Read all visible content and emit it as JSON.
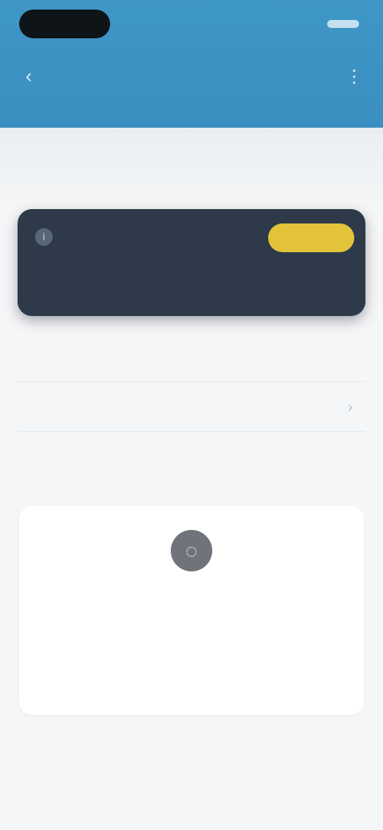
{
  "status_bar": {
    "time_pill": "",
    "right_text": ""
  },
  "nav": {
    "back_icon": "back-arrow-icon",
    "title": "",
    "action_icon": "more-icon"
  },
  "caption": "",
  "promo": {
    "icon": "info-icon",
    "title": "",
    "badge": "",
    "description": ""
  },
  "list": [
    {
      "label": "",
      "value": ""
    },
    {
      "label": "",
      "value": ""
    }
  ],
  "section_title": "",
  "empty_state": {
    "icon": "empty-icon",
    "title": "",
    "description": ""
  },
  "colors": {
    "header": "#3f97c6",
    "promo_bg": "#2e3a4a",
    "badge": "#e2c33a",
    "background": "#f5f6f7"
  }
}
